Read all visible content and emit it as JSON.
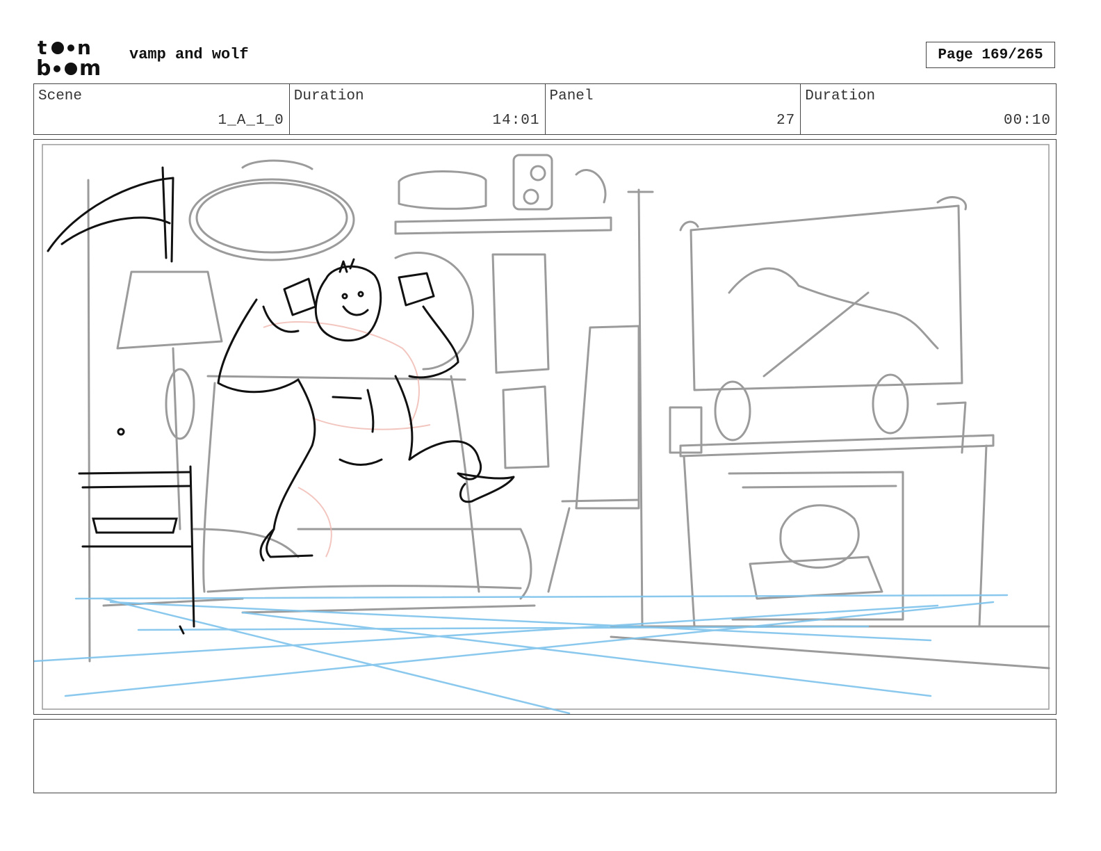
{
  "header": {
    "logo_text": "toon boom",
    "project_title": "vamp and wolf",
    "page_label": "Page 169/265"
  },
  "info": {
    "scene_label": "Scene",
    "scene_value": "1_A_1_0",
    "duration_label": "Duration",
    "duration_value": "14:01",
    "panel_label": "Panel",
    "panel_value": "27",
    "panel_duration_label": "Duration",
    "panel_duration_value": "00:10"
  },
  "panel": {
    "sketch_colors": {
      "character": "#111111",
      "background": "#8a8a8a",
      "perspective": "#7ec3ec",
      "underdrawing": "#f0b8b0"
    }
  },
  "notes": {
    "text": ""
  }
}
